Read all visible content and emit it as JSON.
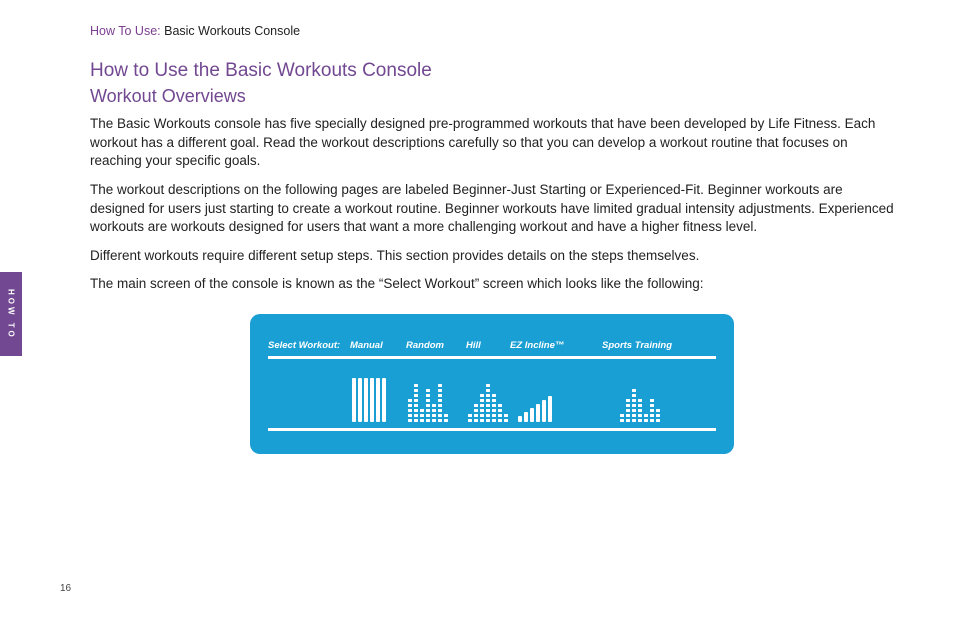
{
  "breadcrumb": {
    "prefix": "How To Use:",
    "rest": " Basic Workouts Console"
  },
  "title": "How to Use the Basic Workouts Console",
  "subtitle": "Workout Overviews",
  "paragraphs": {
    "p1": "The Basic Workouts console has five specially designed pre-programmed workouts that have been developed by Life Fitness. Each workout has a different goal. Read the workout descriptions carefully so that you can develop a workout routine that focuses on reaching your specific goals.",
    "p2": "The workout descriptions on the following pages are labeled Beginner-Just Starting or Experienced-Fit. Beginner workouts are designed for users just starting to create a workout routine. Beginner workouts have limited gradual intensity adjustments. Experienced workouts are workouts designed for users that want a more challenging workout and have a higher fitness level.",
    "p3": "Different workouts require different setup steps. This section provides details on the steps themselves.",
    "p4": "The main screen of the console is known as the “Select Workout” screen which looks like the following:"
  },
  "sidetab": "HOW TO",
  "page_number": "16",
  "console": {
    "labels": {
      "select": "Select Workout:",
      "manual": "Manual",
      "random": "Random",
      "hill": "Hill",
      "ez": "EZ Incline™",
      "sports": "Sports Training"
    }
  }
}
